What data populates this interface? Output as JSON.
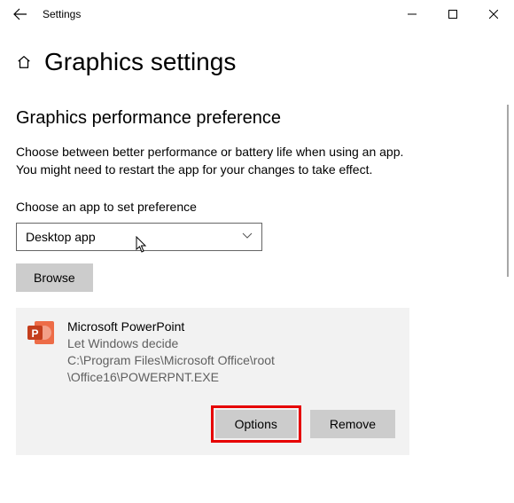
{
  "window": {
    "title": "Settings"
  },
  "page": {
    "title": "Graphics settings",
    "section_heading": "Graphics performance preference",
    "description_line1": "Choose between better performance or battery life when using an app.",
    "description_line2": "You might need to restart the app for your changes to take effect.",
    "choose_label": "Choose an app to set preference",
    "select_value": "Desktop app",
    "browse_label": "Browse"
  },
  "app": {
    "name": "Microsoft PowerPoint",
    "preference": "Let Windows decide",
    "path_line1": "C:\\Program Files\\Microsoft Office\\root",
    "path_line2": "\\Office16\\POWERPNT.EXE",
    "options_label": "Options",
    "remove_label": "Remove"
  }
}
